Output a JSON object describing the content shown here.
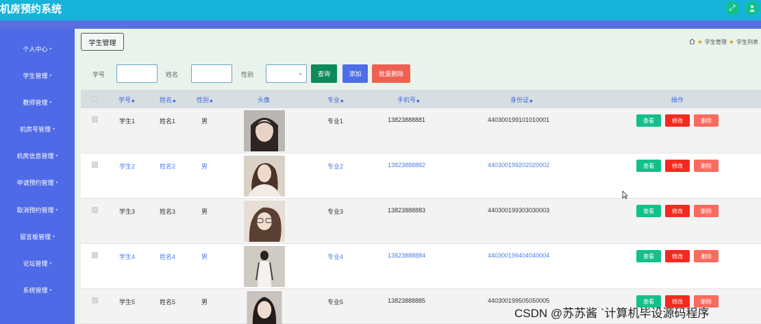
{
  "app": {
    "title": "机房预约系统"
  },
  "header_icons": [
    "fullscreen-icon",
    "user-icon"
  ],
  "sidebar": {
    "items": [
      {
        "label": "个人中心"
      },
      {
        "label": "学生管理"
      },
      {
        "label": "教师管理"
      },
      {
        "label": "机房号管理"
      },
      {
        "label": "机房信息管理"
      },
      {
        "label": "申请预约管理"
      },
      {
        "label": "取消预约管理"
      },
      {
        "label": "留言板管理"
      },
      {
        "label": "论坛管理"
      },
      {
        "label": "系统管理"
      }
    ]
  },
  "page": {
    "tag": "学生管理",
    "breadcrumb": [
      "学生管理",
      "学生列表"
    ]
  },
  "filters": {
    "student_id_label": "学号",
    "name_label": "姓名",
    "gender_label": "性别",
    "query_label": "查询",
    "add_label": "添加",
    "batch_delete_label": "批量删除"
  },
  "colors": {
    "header": "#16b3db",
    "sidebar": "#4e6ae6",
    "query": "#0e8a5a",
    "add": "#4d6ee8",
    "batch_delete": "#f06050",
    "view": "#14c08a",
    "edit": "#f52a1e",
    "delete": "#fb6a5e"
  },
  "table": {
    "headers": {
      "student_id": "学号",
      "name": "姓名",
      "gender": "性别",
      "avatar": "头像",
      "major": "专业",
      "phone": "手机号",
      "id_card": "身份证",
      "actions": "操作"
    },
    "action_labels": {
      "view": "查看",
      "edit": "修改",
      "delete": "删除"
    },
    "rows": [
      {
        "student_id": "学生1",
        "name": "姓名1",
        "gender": "男",
        "major": "专业1",
        "phone": "13823888881",
        "id_card": "440300199101010001"
      },
      {
        "student_id": "学生2",
        "name": "姓名2",
        "gender": "男",
        "major": "专业2",
        "phone": "13823888882",
        "id_card": "440300199202020002"
      },
      {
        "student_id": "学生3",
        "name": "姓名3",
        "gender": "男",
        "major": "专业3",
        "phone": "13823888883",
        "id_card": "440300199303030003"
      },
      {
        "student_id": "学生4",
        "name": "姓名4",
        "gender": "男",
        "major": "专业4",
        "phone": "13823888884",
        "id_card": "440300199404040004"
      },
      {
        "student_id": "学生5",
        "name": "姓名5",
        "gender": "男",
        "major": "专业5",
        "phone": "13823888885",
        "id_card": "440300199505050005"
      }
    ]
  },
  "watermark": "CSDN @苏苏酱    `计算机毕设源码程序"
}
